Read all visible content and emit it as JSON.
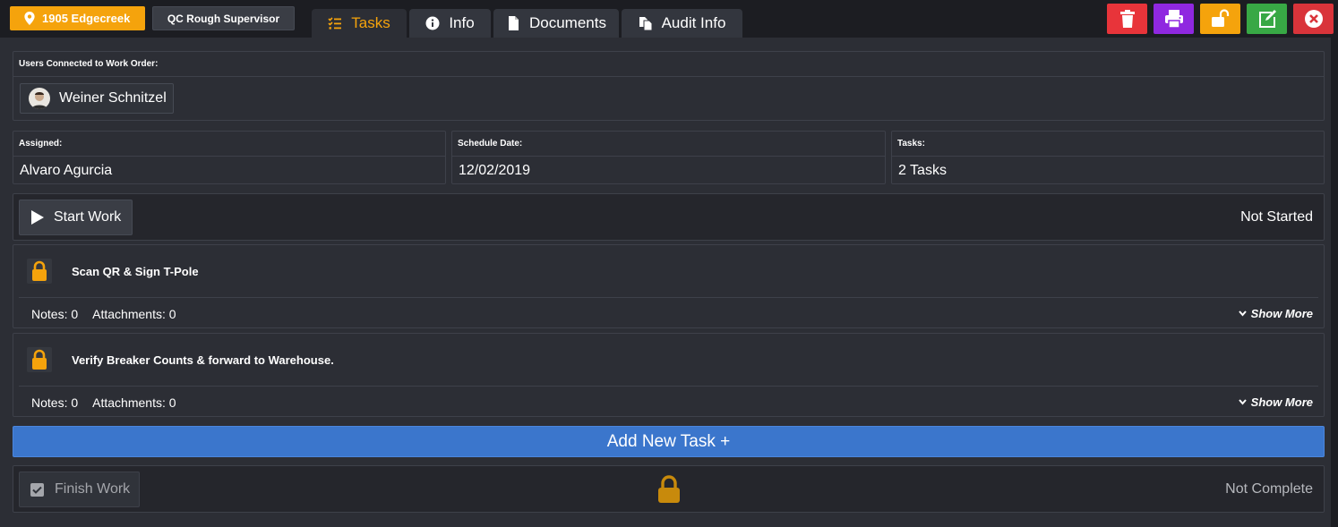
{
  "header": {
    "location_label": "1905 Edgecreek",
    "role_label": "QC Rough Supervisor",
    "tabs": [
      {
        "label": "Tasks",
        "icon": "tasks-icon",
        "active": true
      },
      {
        "label": "Info",
        "icon": "info-icon",
        "active": false
      },
      {
        "label": "Documents",
        "icon": "document-icon",
        "active": false
      },
      {
        "label": "Audit Info",
        "icon": "copy-icon",
        "active": false
      }
    ],
    "actions": [
      {
        "name": "delete",
        "icon": "trash-icon",
        "color": "#e8343a"
      },
      {
        "name": "print",
        "icon": "print-icon",
        "color": "#8f28e0"
      },
      {
        "name": "unlock",
        "icon": "unlock-icon",
        "color": "#f5a30c"
      },
      {
        "name": "edit",
        "icon": "edit-icon",
        "color": "#38a845"
      },
      {
        "name": "close",
        "icon": "close-icon",
        "color": "#d9343a"
      }
    ]
  },
  "users": {
    "label": "Users Connected to Work Order:",
    "items": [
      {
        "name": "Weiner Schnitzel"
      }
    ]
  },
  "info": {
    "assigned_label": "Assigned:",
    "assigned_value": "Alvaro Agurcia",
    "schedule_label": "Schedule Date:",
    "schedule_value": "12/02/2019",
    "tasks_label": "Tasks:",
    "tasks_value": "2 Tasks"
  },
  "work": {
    "start_label": "Start Work",
    "status": "Not Started"
  },
  "tasks": [
    {
      "title": "Scan QR & Sign T-Pole",
      "notes": "Notes: 0",
      "attachments": "Attachments: 0",
      "show_more": "Show More",
      "locked": true
    },
    {
      "title": "Verify Breaker Counts & forward to Warehouse.",
      "notes": "Notes: 0",
      "attachments": "Attachments: 0",
      "show_more": "Show More",
      "locked": true
    }
  ],
  "add_task_label": "Add New Task +",
  "finish": {
    "label": "Finish Work",
    "status": "Not Complete",
    "locked": true
  },
  "colors": {
    "accent": "#f5a30c",
    "primary": "#3b76cc",
    "background": "#2c2e35"
  }
}
